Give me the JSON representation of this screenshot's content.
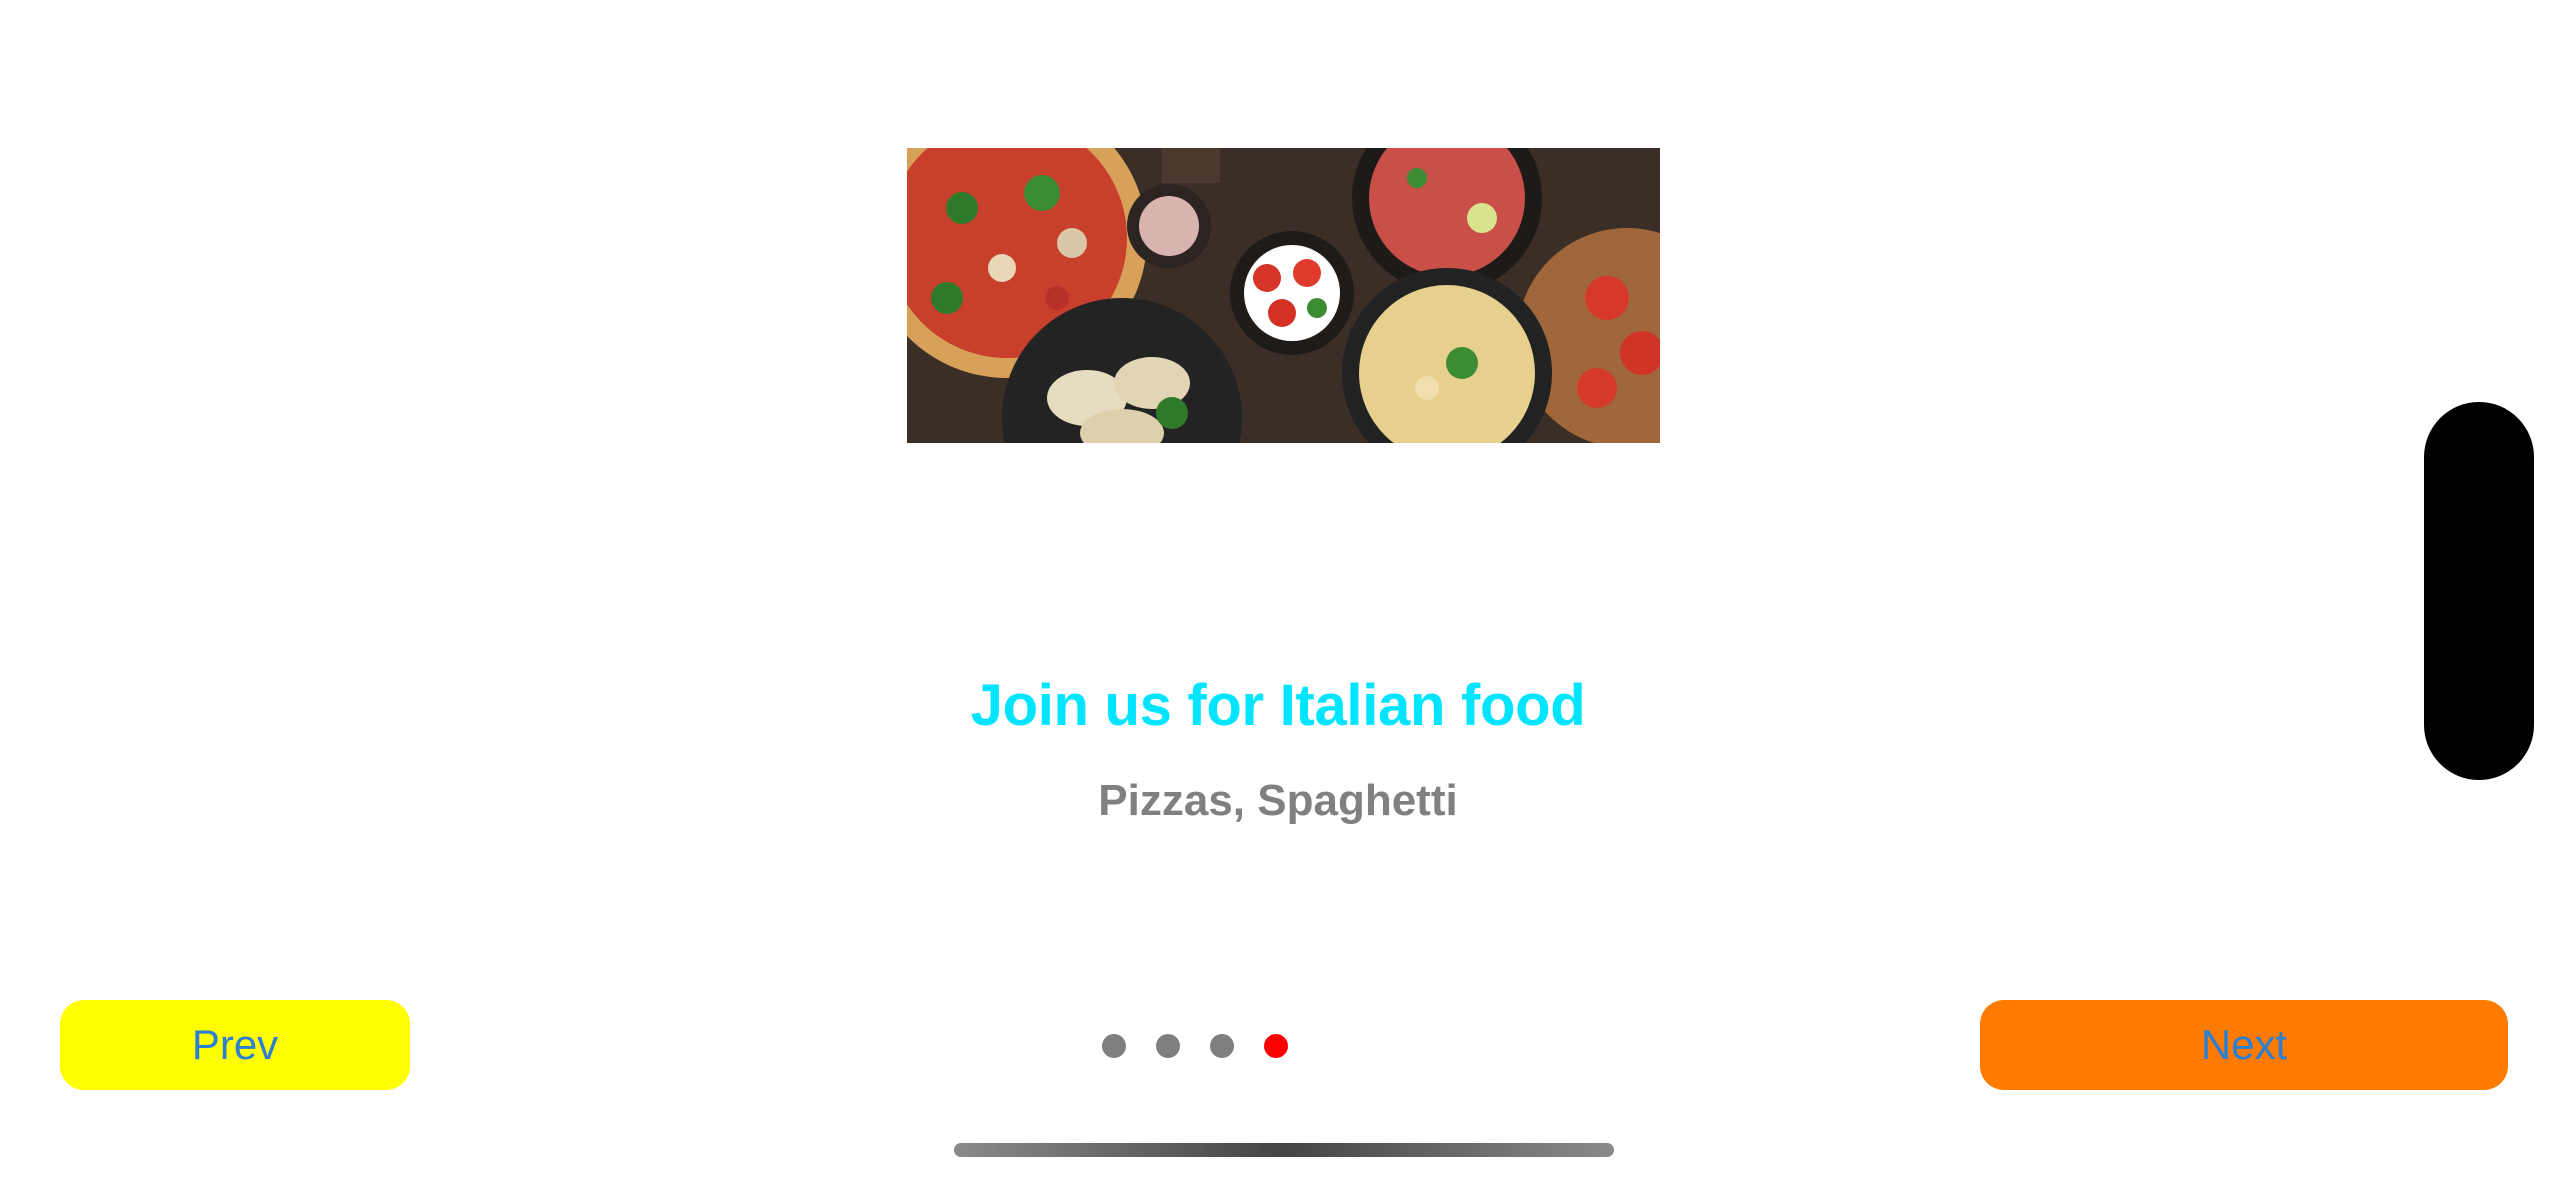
{
  "onboarding": {
    "image_icon": "italian-food-photo",
    "title": "Join us for Italian food",
    "subtitle": "Pizzas, Spaghetti",
    "title_color": "#00e5ff",
    "subtitle_color": "#808080"
  },
  "navigation": {
    "prev_label": "Prev",
    "next_label": "Next",
    "prev_color": "#ffff00",
    "next_color": "#ff7a00",
    "label_color": "#2d7fd1"
  },
  "pager": {
    "total_pages": 4,
    "current_page": 4,
    "active_color": "#ff0000",
    "inactive_color": "#7f7f7f"
  }
}
